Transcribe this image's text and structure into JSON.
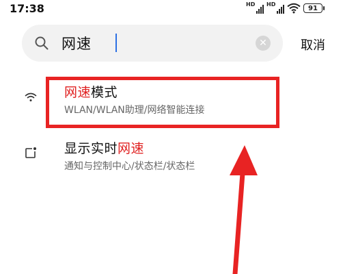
{
  "status_bar": {
    "time": "17:38",
    "signal1_label": "HD",
    "signal2_label": "HD",
    "battery": "91"
  },
  "search": {
    "query": "网速",
    "cancel_label": "取消"
  },
  "results": [
    {
      "title_highlight": "网速",
      "title_rest": "模式",
      "subtitle": "WLAN/WLAN助理/网络智能连接",
      "icon": "wifi-icon"
    },
    {
      "title_rest": "显示实时",
      "title_highlight": "网速",
      "subtitle": "通知与控制中心/状态栏/状态栏",
      "icon": "status-bar-icon"
    }
  ],
  "colors": {
    "highlight": "#e02020",
    "annotation": "#e82323",
    "caret": "#2b6fe3"
  }
}
